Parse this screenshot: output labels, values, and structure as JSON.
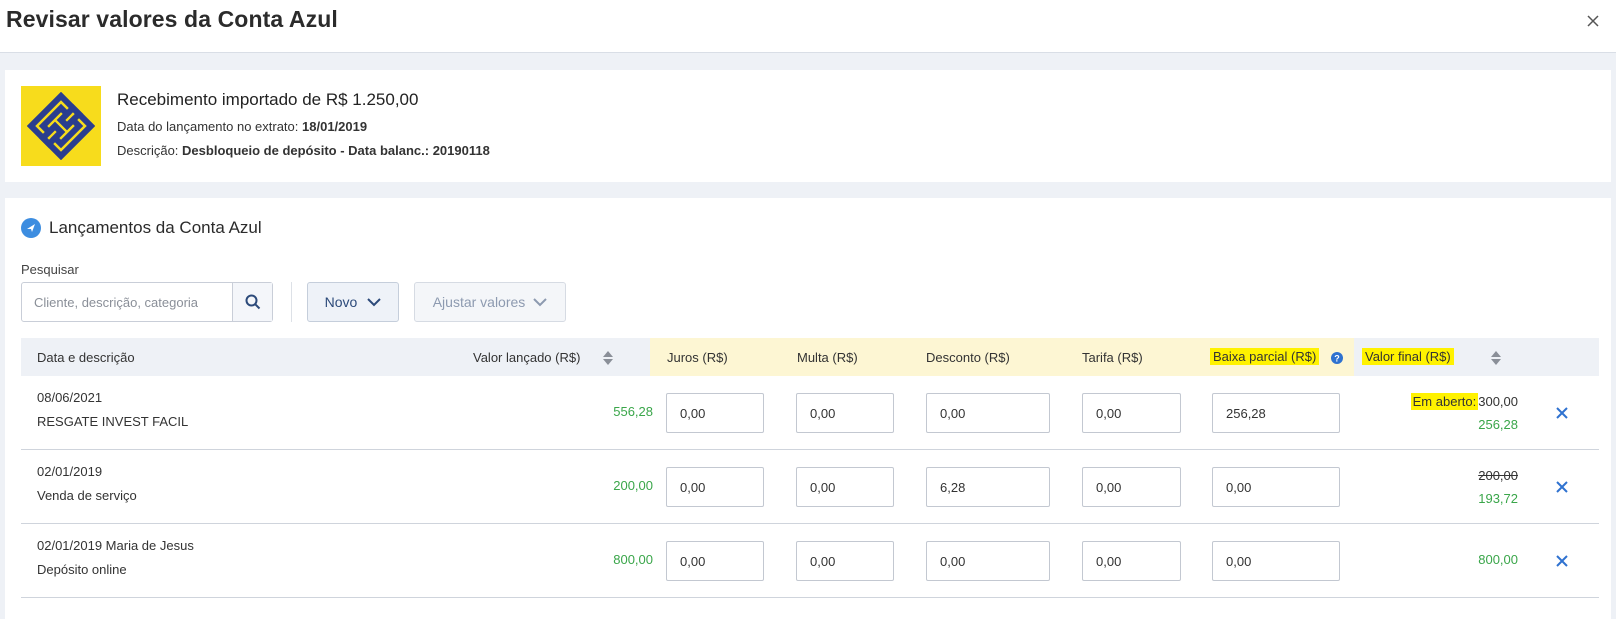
{
  "dialog": {
    "title": "Revisar valores da Conta Azul"
  },
  "import_info": {
    "title": "Recebimento importado de R$ 1.250,00",
    "date_label": "Data do lançamento no extrato:",
    "date_value": "18/01/2019",
    "desc_label": "Descrição:",
    "desc_value": "Desbloqueio de depósito - Data balanc.: 20190118",
    "bank_logo_color": "#f7dc1c",
    "bank_logo_accent": "#2a3d8f"
  },
  "section": {
    "title": "Lançamentos da Conta Azul",
    "search_label": "Pesquisar",
    "search_placeholder": "Cliente, descrição, categoria",
    "novo_label": "Novo",
    "ajustar_label": "Ajustar valores"
  },
  "table": {
    "headers": {
      "date_desc": "Data e descrição",
      "valor_lancado": "Valor lançado (R$)",
      "juros": "Juros (R$)",
      "multa": "Multa (R$)",
      "desconto": "Desconto (R$)",
      "tarifa": "Tarifa (R$)",
      "baixa_parcial": "Baixa parcial (R$)",
      "valor_final": "Valor final (R$)"
    },
    "rows": [
      {
        "date": "08/06/2021",
        "description": "RESGATE INVEST FACIL",
        "valor_lancado": "556,28",
        "juros": "0,00",
        "multa": "0,00",
        "desconto": "0,00",
        "tarifa": "0,00",
        "baixa_parcial": "256,28",
        "final_label": "Em aberto:",
        "final_top": "300,00",
        "final_bottom": "256,28"
      },
      {
        "date": "02/01/2019",
        "description": "Venda de serviço",
        "valor_lancado": "200,00",
        "juros": "0,00",
        "multa": "0,00",
        "desconto": "6,28",
        "tarifa": "0,00",
        "baixa_parcial": "0,00",
        "final_top": "200,00",
        "final_bottom": "193,72"
      },
      {
        "date": "02/01/2019 Maria de Jesus",
        "description": "Depósito online",
        "valor_lancado": "800,00",
        "juros": "0,00",
        "multa": "0,00",
        "desconto": "0,00",
        "tarifa": "0,00",
        "baixa_parcial": "0,00",
        "final_single": "800,00"
      }
    ]
  },
  "colors": {
    "positive": "#3aa64a",
    "highlight": "#fff200",
    "highlight_band": "#fdf6d3",
    "remove_icon": "#2f72d0"
  }
}
